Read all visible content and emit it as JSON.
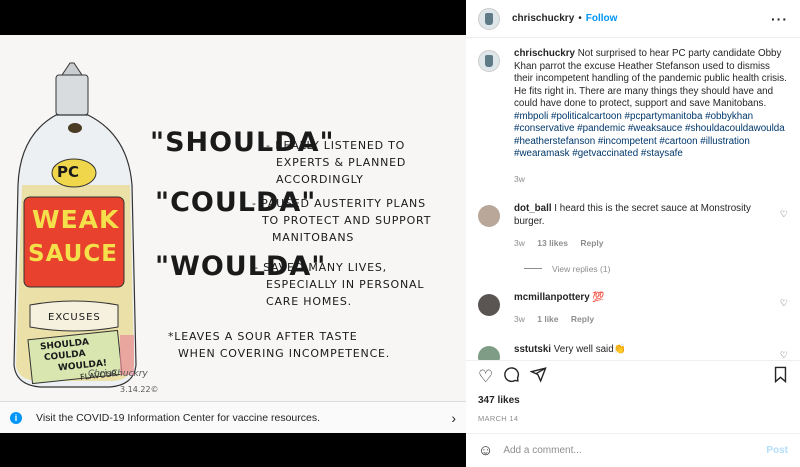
{
  "post_header": {
    "username": "chrischuckry",
    "separator": "•",
    "follow_label": "Follow",
    "more_icon": "more-options-icon"
  },
  "cartoon": {
    "pc_label": "PC",
    "bottle_weak": "WEAK",
    "bottle_sauce": "SAUCE",
    "bottle_excuses": "EXCUSES",
    "bottle_sticker": [
      "SHOULDA",
      "COULDA",
      "WOULDA!",
      "FLAVOUR"
    ],
    "shoulda": "\"SHOULDA\"",
    "shoulda_desc": [
      "- REALLY LISTENED TO",
      "EXPERTS & PLANNED",
      "ACCORDINGLY"
    ],
    "coulda": "\"COULDA\"",
    "coulda_desc": [
      "- PAUSED AUSTERITY PLANS",
      "TO PROTECT AND SUPPORT",
      "MANITOBANS"
    ],
    "woulda": "\"WOULDA\"",
    "woulda_desc": [
      "- SAVED MANY LIVES,",
      "ESPECIALLY IN PERSONAL",
      "CARE HOMES."
    ],
    "footnote": [
      "*LEAVES A SOUR AFTER TASTE",
      "WHEN COVERING INCOMPETENCE."
    ],
    "signature": "ChrisChuckry",
    "sig_date": "3.14.22©"
  },
  "covid_banner": {
    "text": "Visit the COVID-19 Information Center for vaccine resources.",
    "icon": "info-icon",
    "chevron": "›"
  },
  "caption": {
    "username": "chrischuckry",
    "text": "Not surprised to hear PC party candidate Obby Khan parrot the excuse Heather Stefanson used to dismiss their incompetent handling of the pandemic public health crisis. He fits right in. There are many things they should have and could have done to protect, support and save Manitobans.",
    "hashtags": "#mbpoli #politicalcartoon #pcpartymanitoba #obbykhan #conservative #pandemic #weaksauce #shouldacouldawoulda #heatherstefanson #incompetent #cartoon #illustration #wearamask #getvaccinated #staysafe",
    "time": "3w"
  },
  "comments": [
    {
      "username": "dot_ball",
      "text": "I heard this is the secret sauce at Monstrosity burger.",
      "time": "3w",
      "likes": "13 likes",
      "reply": "Reply"
    },
    {
      "username": "mcmillanpottery",
      "text": "💯",
      "time": "3w",
      "likes": "1 like",
      "reply": "Reply"
    },
    {
      "username": "sstutski",
      "text": "Very well said👏",
      "time": "",
      "likes": "",
      "reply": ""
    }
  ],
  "view_replies": "View replies (1)",
  "actions": {
    "likes": "347 likes",
    "date": "MARCH 14"
  },
  "add_comment": {
    "placeholder": "Add a comment...",
    "post_label": "Post"
  }
}
